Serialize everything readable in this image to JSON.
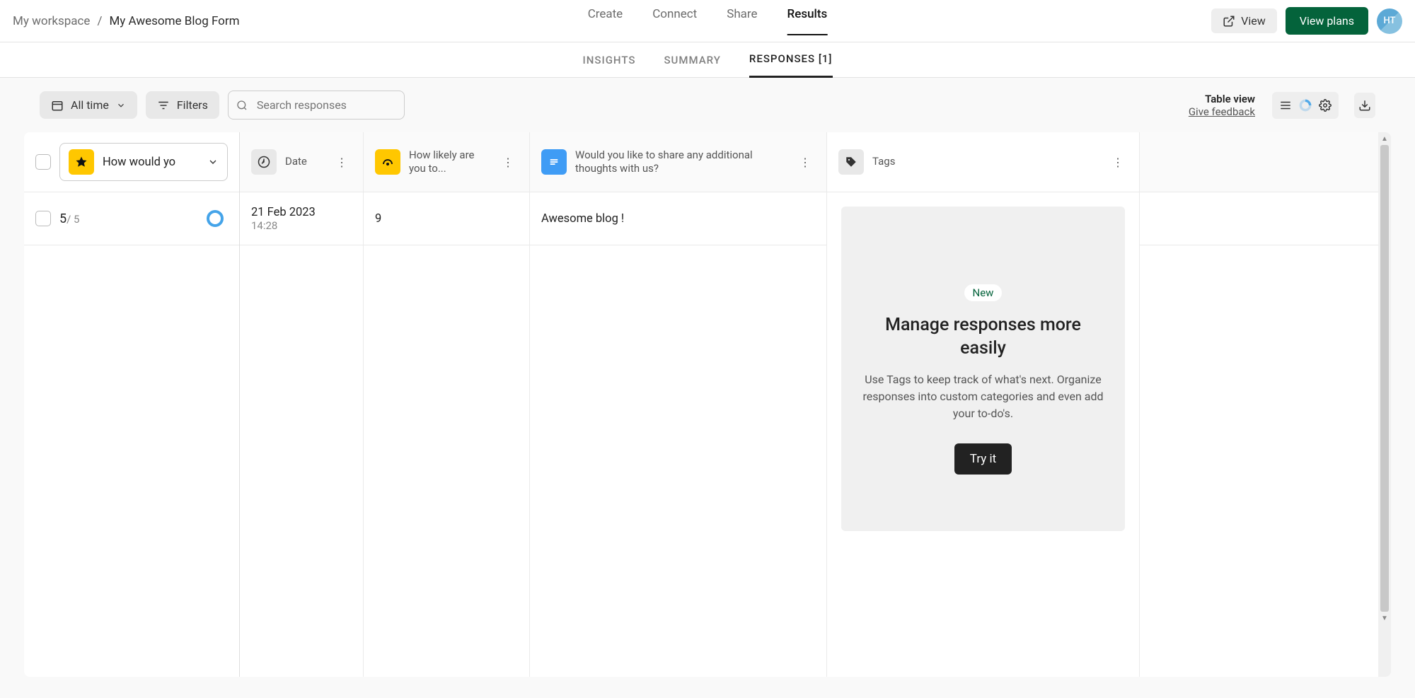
{
  "breadcrumb": {
    "workspace": "My workspace",
    "separator": "/",
    "current": "My Awesome Blog Form"
  },
  "top_nav": {
    "create": "Create",
    "connect": "Connect",
    "share": "Share",
    "results": "Results"
  },
  "header": {
    "view_label": "View",
    "plans_label": "View plans",
    "avatar_initials": "HT"
  },
  "sub_nav": {
    "insights": "INSIGHTS",
    "summary": "SUMMARY",
    "responses": "RESPONSES [1]"
  },
  "toolbar": {
    "time_filter": "All time",
    "filters_label": "Filters",
    "search_placeholder": "Search responses",
    "table_view_title": "Table view",
    "feedback_link": "Give feedback"
  },
  "columns": {
    "question_select": "How would yo",
    "date": "Date",
    "nps": "How likely are you to...",
    "thoughts": "Would you like to share any additional thoughts with us?",
    "tags": "Tags"
  },
  "row": {
    "score_value": "5",
    "score_max": "/ 5",
    "date": "21 Feb 2023",
    "time": "14:28",
    "nps_value": "9",
    "thoughts_value": "Awesome blog !"
  },
  "promo": {
    "badge": "New",
    "title": "Manage responses more easily",
    "body": "Use Tags to keep track of what's next. Organize responses into custom categories and even add your to-do's.",
    "cta": "Try it"
  }
}
